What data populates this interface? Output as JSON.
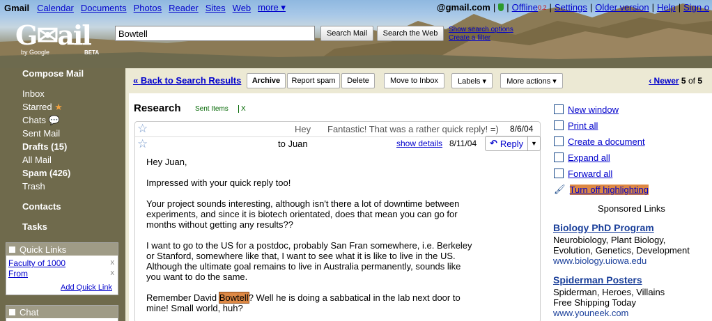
{
  "topbar": {
    "brand": "Gmail",
    "links": [
      "Calendar",
      "Documents",
      "Photos",
      "Reader",
      "Sites",
      "Web"
    ],
    "more": "more ▾",
    "email": "@gmail.com",
    "offline": "Offline",
    "offline_count": "0.2",
    "settings": "Settings",
    "older_version": "Older version",
    "help": "Help",
    "sign_out": "Sign o"
  },
  "logo": {
    "by": "by Google",
    "beta": "BETA"
  },
  "search": {
    "value": "Bowtell",
    "search_mail": "Search Mail",
    "search_web": "Search the Web",
    "show_options": "Show search options",
    "create_filter": "Create a filter"
  },
  "sidebar": {
    "compose": "Compose Mail",
    "inbox": "Inbox",
    "starred": "Starred",
    "chats": "Chats",
    "sent": "Sent Mail",
    "drafts": "Drafts (15)",
    "all_mail": "All Mail",
    "spam": "Spam (426)",
    "trash": "Trash",
    "contacts": "Contacts",
    "tasks": "Tasks",
    "quick_links": {
      "title": "Quick Links",
      "items": [
        "Faculty of 1000",
        "From"
      ],
      "add": "Add Quick Link"
    },
    "chat_title": "Chat"
  },
  "toolbar": {
    "back": "« Back to Search Results",
    "archive": "Archive",
    "report_spam": "Report spam",
    "delete": "Delete",
    "move_inbox": "Move to Inbox",
    "labels": "Labels ▾",
    "more_actions": "More actions ▾",
    "newer": "‹ Newer",
    "page_current": "5",
    "page_of": "of",
    "page_total": "5"
  },
  "thread": {
    "subject": "Research",
    "label": "Sent Items",
    "label_x": "X",
    "msg1": {
      "snippet_from": "Hey",
      "snippet": "Fantastic! That was a rather quick reply! =)",
      "date": "8/6/04"
    },
    "msg2": {
      "to": "to Juan",
      "show_details": "show details",
      "date": "8/11/04",
      "reply": "Reply"
    },
    "body": {
      "p1": "Hey Juan,",
      "p2": "Impressed with your quick reply too!",
      "p3": "Your project sounds interesting,  although isn't there a lot of downtime between experiments, and since it is biotech orientated, does that mean you can go for months without getting any results??",
      "p4": "I want to go to the US for a postdoc, probably San Fran somewhere, i.e. Berkeley or Stanford, somewhere like that, I want to see what it is like to live in the US. Although the ultimate goal remains to live in Australia permanently, sounds like you want to do the same.",
      "p5_a": "Remember David ",
      "p5_hl": "Bowtell",
      "p5_b": "?  Well he is doing a sabbatical in the lab next door to mine!  Small world, huh?"
    }
  },
  "actions": {
    "new_window": "New window",
    "print_all": "Print all",
    "create_doc": "Create a document",
    "expand_all": "Expand all",
    "forward_all": "Forward all",
    "turn_off_highlight": "Turn off highlighting"
  },
  "ads": {
    "title": "Sponsored Links",
    "items": [
      {
        "title": "Biology PhD Program",
        "line1": "Neurobiology, Plant Biology,",
        "line2": "Evolution, Genetics, Development",
        "url": "www.biology.uiowa.edu"
      },
      {
        "title": "Spiderman Posters",
        "line1": "Spiderman, Heroes, Villains",
        "line2": "Free Shipping Today",
        "url": "www.youneek.com"
      }
    ]
  },
  "colors": {
    "sidebar_bg": "#6f6a4c",
    "highlight": "#dd8844",
    "link": "#0000cc"
  }
}
